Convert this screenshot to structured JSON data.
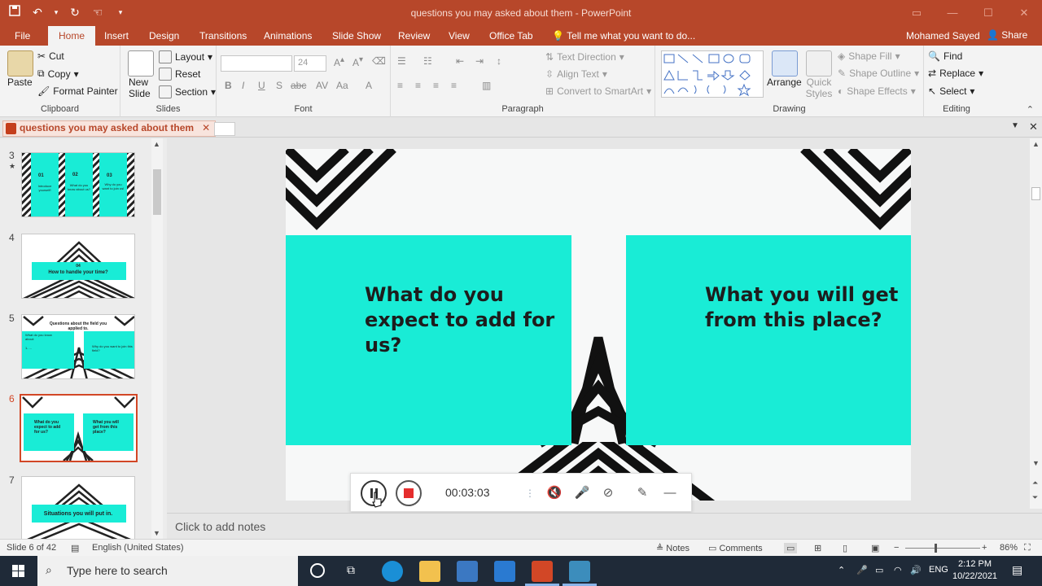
{
  "window": {
    "title": "questions you may asked about them - PowerPoint",
    "user": "Mohamed Sayed",
    "share_label": "Share"
  },
  "ribbon_tabs": [
    "File",
    "Home",
    "Insert",
    "Design",
    "Transitions",
    "Animations",
    "Slide Show",
    "Review",
    "View",
    "Office Tab"
  ],
  "tell_me": "Tell me what you want to do...",
  "clipboard": {
    "paste": "Paste",
    "cut": "Cut",
    "copy": "Copy",
    "format_painter": "Format Painter",
    "label": "Clipboard"
  },
  "slides_group": {
    "new_slide": "New Slide",
    "layout": "Layout",
    "reset": "Reset",
    "section": "Section",
    "label": "Slides"
  },
  "font_group": {
    "font_size": "24",
    "label": "Font"
  },
  "paragraph_group": {
    "text_direction": "Text Direction",
    "align_text": "Align Text",
    "convert_smartart": "Convert to SmartArt",
    "label": "Paragraph"
  },
  "drawing_group": {
    "arrange": "Arrange",
    "quick_styles": "Quick Styles",
    "shape_fill": "Shape Fill",
    "shape_outline": "Shape Outline",
    "shape_effects": "Shape Effects",
    "label": "Drawing"
  },
  "editing_group": {
    "find": "Find",
    "replace": "Replace",
    "select": "Select",
    "label": "Editing"
  },
  "doc_tab": {
    "name": "questions you may asked about them"
  },
  "thumbnails": [
    {
      "num": "3",
      "star": "★",
      "texts": [
        "01",
        "Introduce yourself!",
        "02",
        "What do you know about us?",
        "03",
        "Why do you want to join us!"
      ]
    },
    {
      "num": "4",
      "texts": [
        "04",
        "How to handle your time?"
      ]
    },
    {
      "num": "5",
      "texts": [
        "Questions about the field you applied to.",
        "What do you know about:",
        "1- ...",
        "Why do you want to join this field?"
      ]
    },
    {
      "num": "6",
      "texts": [
        "What do you expect to add for us?",
        "What you will get from this place?"
      ]
    },
    {
      "num": "7",
      "texts": [
        "Situations you will put in."
      ]
    }
  ],
  "slide": {
    "left_card": "What do you expect to add for us?",
    "right_card": "What you will get from this place?"
  },
  "recorder": {
    "time": "00:03:03"
  },
  "notes_placeholder": "Click to add notes",
  "status": {
    "slide_info": "Slide 6 of 42",
    "language": "English (United States)",
    "notes": "Notes",
    "comments": "Comments",
    "zoom": "86%"
  },
  "taskbar": {
    "search": "Type here to search",
    "lang": "ENG",
    "time": "2:12 PM",
    "date": "10/22/2021"
  },
  "colors": {
    "accent": "#b7472a",
    "teal": "#19ecd6"
  }
}
